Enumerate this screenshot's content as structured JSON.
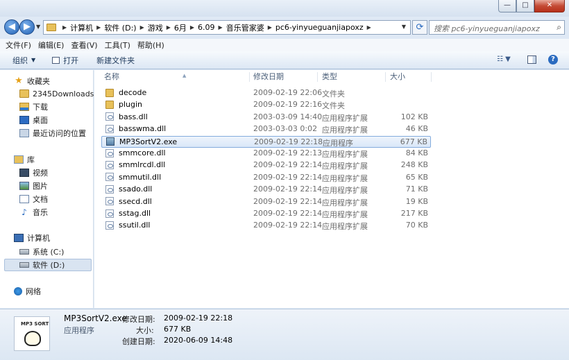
{
  "window": {
    "caption_minimize": "—",
    "caption_maximize": "□",
    "caption_close": "✕"
  },
  "address": {
    "crumbs": [
      "计算机",
      "软件 (D:)",
      "游戏",
      "6月",
      "6.09",
      "音乐管家婆",
      "pc6-yinyueguanjiapoxz"
    ],
    "search_placeholder": "搜索 pc6-yinyueguanjiapoxz"
  },
  "menu": [
    "文件(F)",
    "编辑(E)",
    "查看(V)",
    "工具(T)",
    "帮助(H)"
  ],
  "toolbar": {
    "organize": "组织",
    "open": "打开",
    "new_folder": "新建文件夹"
  },
  "nav": {
    "favorites": "收藏夹",
    "downloads2345": "2345Downloads",
    "downloads": "下载",
    "desktop": "桌面",
    "recent": "最近访问的位置",
    "libraries": "库",
    "videos": "视频",
    "pictures": "图片",
    "documents": "文档",
    "music": "音乐",
    "computer": "计算机",
    "drive_c": "系统 (C:)",
    "drive_d": "软件 (D:)",
    "network": "网络"
  },
  "columns": {
    "name": "名称",
    "date": "修改日期",
    "type": "类型",
    "size": "大小"
  },
  "files": [
    {
      "name": "decode",
      "date": "2009-02-19 22:06",
      "type": "文件夹",
      "size": "",
      "kind": "folder"
    },
    {
      "name": "plugin",
      "date": "2009-02-19 22:16",
      "type": "文件夹",
      "size": "",
      "kind": "folder"
    },
    {
      "name": "bass.dll",
      "date": "2003-03-09 14:40",
      "type": "应用程序扩展",
      "size": "102 KB",
      "kind": "dll"
    },
    {
      "name": "basswma.dll",
      "date": "2003-03-03 0:02",
      "type": "应用程序扩展",
      "size": "46 KB",
      "kind": "dll"
    },
    {
      "name": "MP3SortV2.exe",
      "date": "2009-02-19 22:18",
      "type": "应用程序",
      "size": "677 KB",
      "kind": "exe"
    },
    {
      "name": "smmcore.dll",
      "date": "2009-02-19 22:13",
      "type": "应用程序扩展",
      "size": "84 KB",
      "kind": "dll"
    },
    {
      "name": "smmlrcdl.dll",
      "date": "2009-02-19 22:14",
      "type": "应用程序扩展",
      "size": "248 KB",
      "kind": "dll"
    },
    {
      "name": "smmutil.dll",
      "date": "2009-02-19 22:14",
      "type": "应用程序扩展",
      "size": "65 KB",
      "kind": "dll"
    },
    {
      "name": "ssado.dll",
      "date": "2009-02-19 22:14",
      "type": "应用程序扩展",
      "size": "71 KB",
      "kind": "dll"
    },
    {
      "name": "ssecd.dll",
      "date": "2009-02-19 22:14",
      "type": "应用程序扩展",
      "size": "19 KB",
      "kind": "dll"
    },
    {
      "name": "sstag.dll",
      "date": "2009-02-19 22:14",
      "type": "应用程序扩展",
      "size": "217 KB",
      "kind": "dll"
    },
    {
      "name": "ssutil.dll",
      "date": "2009-02-19 22:14",
      "type": "应用程序扩展",
      "size": "70 KB",
      "kind": "dll"
    }
  ],
  "selected_file": "MP3SortV2.exe",
  "details": {
    "name": "MP3SortV2.exe",
    "type": "应用程序",
    "modified_label": "修改日期:",
    "modified": "2009-02-19 22:18",
    "size_label": "大小:",
    "size": "677 KB",
    "created_label": "创建日期:",
    "created": "2020-06-09 14:48",
    "thumb_text": "MP3 SORT"
  }
}
